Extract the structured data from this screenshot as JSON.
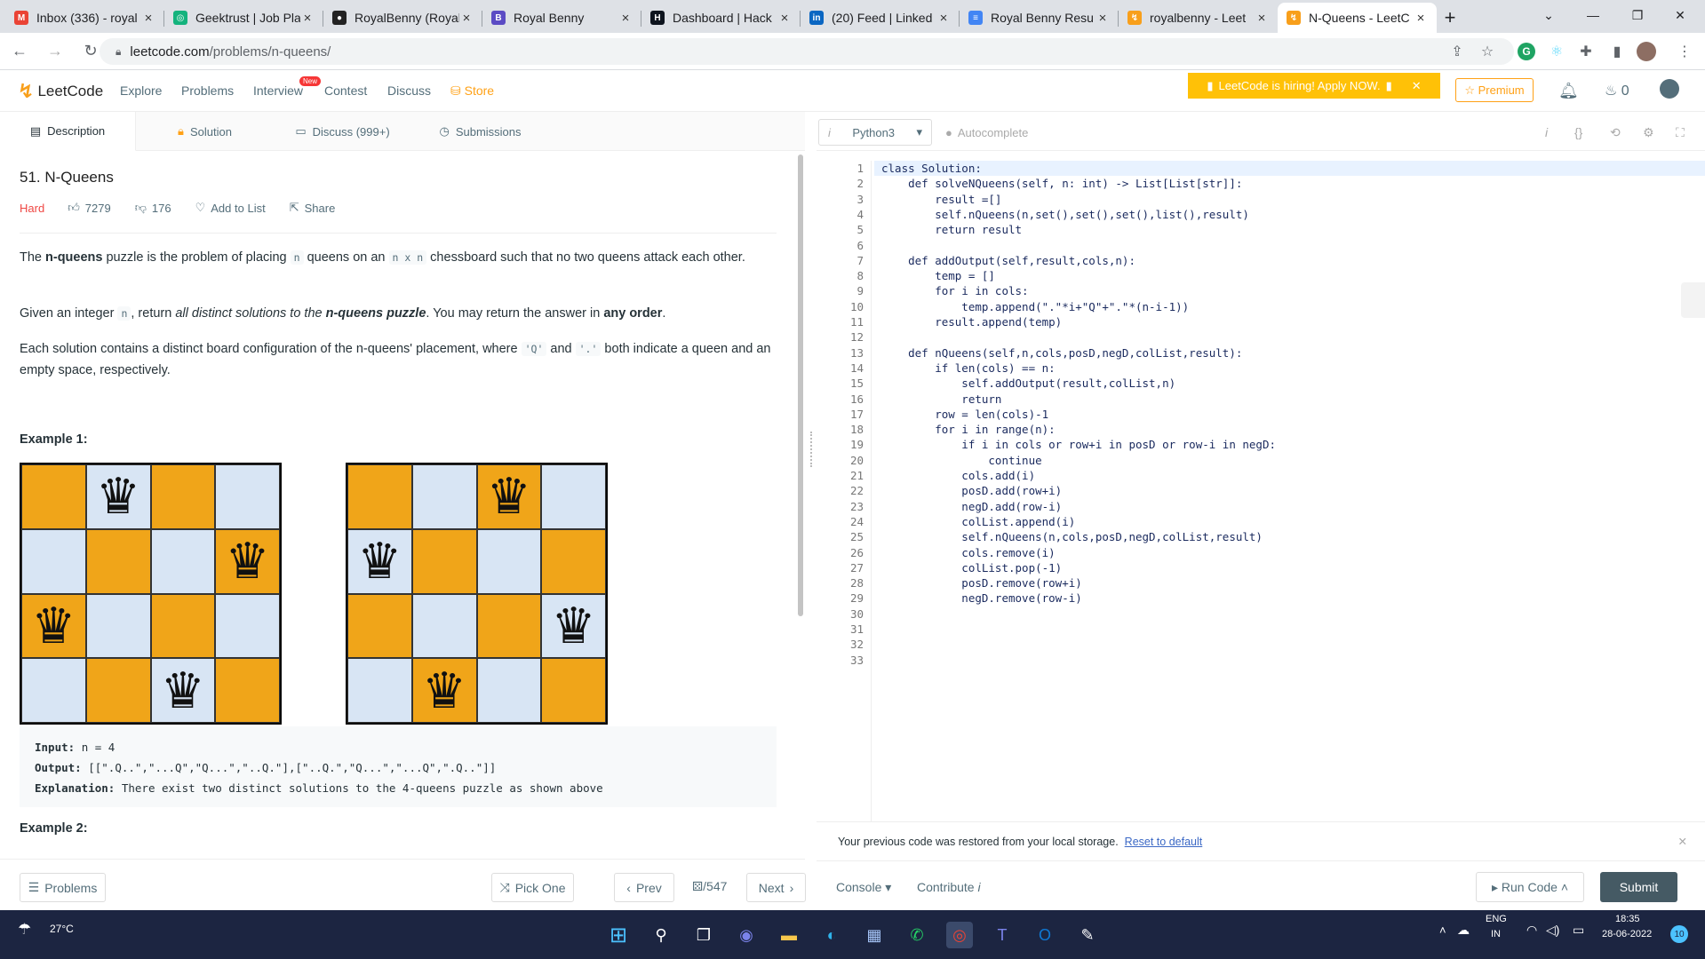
{
  "browser": {
    "tabs": [
      {
        "label": "Inbox (336) - royal",
        "icon": "gmail-icon",
        "color": "#ea4335",
        "glyph": "M"
      },
      {
        "label": "Geektrust | Job Pla",
        "icon": "geektrust-icon",
        "color": "#14b37d",
        "glyph": "◎"
      },
      {
        "label": "RoyalBenny (Royal",
        "icon": "github-icon",
        "color": "#222222",
        "glyph": "●"
      },
      {
        "label": "Royal Benny",
        "icon": "b-site-icon",
        "color": "#5b4bc4",
        "glyph": "B"
      },
      {
        "label": "Dashboard | Hack",
        "icon": "hackerrank-icon",
        "color": "#0e141e",
        "glyph": "H"
      },
      {
        "label": "(20) Feed | Linked",
        "icon": "linkedin-icon",
        "color": "#0a66c2",
        "glyph": "in"
      },
      {
        "label": "Royal Benny Resu",
        "icon": "docs-icon",
        "color": "#4285f4",
        "glyph": "≡"
      },
      {
        "label": "royalbenny - Leet",
        "icon": "leetcode-icon",
        "color": "#f89f1b",
        "glyph": "↯"
      },
      {
        "label": "N-Queens - LeetC",
        "icon": "leetcode-icon",
        "color": "#f89f1b",
        "glyph": "↯"
      }
    ],
    "url_domain": "leetcode.com",
    "url_path": "/problems/n-queens/"
  },
  "nav": {
    "logo": "LeetCode",
    "items": [
      "Explore",
      "Problems",
      "Interview",
      "Contest",
      "Discuss"
    ],
    "new_badge": "New",
    "store": "Store",
    "hiring": "LeetCode is hiring! Apply NOW.",
    "premium": "Premium",
    "coins": "0"
  },
  "left_tabs": [
    "Description",
    "Solution",
    "Discuss (999+)",
    "Submissions"
  ],
  "problem": {
    "title": "51. N-Queens",
    "difficulty": "Hard",
    "likes": "7279",
    "dislikes": "176",
    "add_to_list": "Add to List",
    "share": "Share",
    "p1_a": "The ",
    "p1_b": "n-queens",
    "p1_c": " puzzle is the problem of placing ",
    "p1_code1": "n",
    "p1_d": " queens on an ",
    "p1_code2": "n x n",
    "p1_e": " chessboard such that no two queens attack each other.",
    "p2_a": "Given an integer ",
    "p2_code": "n",
    "p2_b": ", return ",
    "p2_c": "all distinct solutions to the ",
    "p2_d": "n-queens puzzle",
    "p2_e": ". You may return the answer in ",
    "p2_f": "any order",
    "p2_g": ".",
    "p3_a": "Each solution contains a distinct board configuration of the n-queens' placement, where ",
    "p3_code1": "'Q'",
    "p3_b": " and ",
    "p3_code2": "'.'",
    "p3_c": " both indicate a queen and an empty space, respectively.",
    "example1": "Example 1:",
    "input_label": "Input:",
    "input_value": "n = 4",
    "output_label": "Output:",
    "output_value": "[[\".Q..\",\"...Q\",\"Q...\",\"..Q.\"],[\"..Q.\",\"Q...\",\"...Q\",\".Q..\"]]",
    "explanation_label": "Explanation:",
    "explanation_value": "There exist two distinct solutions to the 4-queens puzzle as shown above",
    "example2": "Example 2:",
    "boards": [
      {
        "queens": [
          1,
          3,
          0,
          2
        ]
      },
      {
        "queens": [
          2,
          0,
          3,
          1
        ]
      }
    ],
    "queen_glyph": "♛"
  },
  "left_bottom": {
    "problems": "Problems",
    "pick_one": "Pick One",
    "prev": "Prev",
    "page": "/547",
    "next": "Next"
  },
  "editor": {
    "language": "Python3",
    "autocomplete": "Autocomplete",
    "line_numbers": [
      "1",
      "2",
      "3",
      "4",
      "5",
      "6",
      "7",
      "8",
      "9",
      "10",
      "11",
      "12",
      "13",
      "14",
      "15",
      "16",
      "17",
      "18",
      "19",
      "20",
      "21",
      "22",
      "23",
      "24",
      "25",
      "26",
      "27",
      "28",
      "29",
      "30",
      "31",
      "32",
      "33"
    ],
    "lines": [
      "class Solution:",
      "    def solveNQueens(self, n: int) -> List[List[str]]:",
      "        result =[]",
      "        self.nQueens(n,set(),set(),set(),list(),result)",
      "        return result",
      "",
      "    def addOutput(self,result,cols,n):",
      "        temp = []",
      "        for i in cols:",
      "            temp.append(\".\"*i+\"Q\"+\".\"*(n-i-1))",
      "        result.append(temp)",
      "",
      "    def nQueens(self,n,cols,posD,negD,colList,result):",
      "        if len(cols) == n:",
      "            self.addOutput(result,colList,n)",
      "            return",
      "        row = len(cols)-1",
      "        for i in range(n):",
      "            if i in cols or row+i in posD or row-i in negD:",
      "                continue",
      "            cols.add(i)",
      "            posD.add(row+i)",
      "            negD.add(row-i)",
      "            colList.append(i)",
      "            self.nQueens(n,cols,posD,negD,colList,result)",
      "            cols.remove(i)",
      "            colList.pop(-1)",
      "            posD.remove(row+i)",
      "            negD.remove(row-i)",
      "",
      "",
      "",
      ""
    ],
    "restore_msg": "Your previous code was restored from your local storage.",
    "reset": "Reset to default",
    "console": "Console",
    "contribute": "Contribute",
    "run_code": "Run Code",
    "submit": "Submit"
  },
  "taskbar": {
    "weather": "27°C",
    "lang1": "ENG",
    "lang2": "IN",
    "time": "18:35",
    "date": "28-06-2022",
    "notif": "10"
  },
  "colors": {
    "orange_square": "#f0a519",
    "blue_square": "#d8e5f4",
    "accent": "#ffa116",
    "submit_bg": "#455a64"
  }
}
